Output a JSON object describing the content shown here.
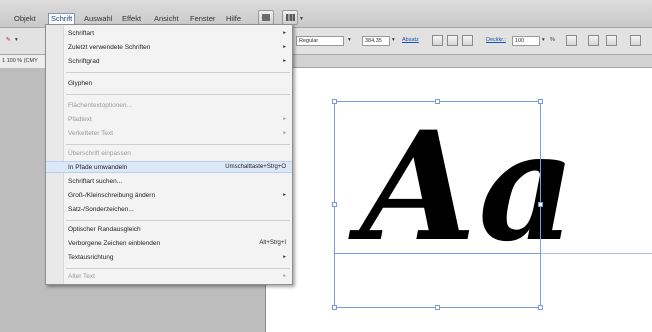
{
  "menubar": {
    "items": [
      "Objekt",
      "Schrift",
      "Auswahl",
      "Effekt",
      "Ansicht",
      "Fenster",
      "Hilfe"
    ],
    "active": "Schrift"
  },
  "controlbar": {
    "style_value": "Regular",
    "size_value": "384,35",
    "link_absatz": "Absatz",
    "opacity_label": "Deckkr.:",
    "opacity_value": "100",
    "percent": "%"
  },
  "document_tab": {
    "label": "1 100 % (CMY"
  },
  "artwork": {
    "text": "Aa"
  },
  "menu": {
    "items": [
      {
        "label": "Schriftart",
        "shortcut": "",
        "submenu": true,
        "enabled": true
      },
      {
        "label": "Zuletzt verwendete Schriften",
        "shortcut": "",
        "submenu": true,
        "enabled": true
      },
      {
        "label": "Schriftgrad",
        "shortcut": "",
        "submenu": true,
        "enabled": true
      },
      {
        "label": "Glyphen",
        "shortcut": "",
        "submenu": false,
        "enabled": true
      },
      {
        "label": "Flächentextoptionen...",
        "shortcut": "",
        "submenu": false,
        "enabled": false
      },
      {
        "label": "Pfadtext",
        "shortcut": "",
        "submenu": true,
        "enabled": false
      },
      {
        "label": "Verketteter Text",
        "shortcut": "",
        "submenu": true,
        "enabled": false
      },
      {
        "label": "Überschrift einpassen",
        "shortcut": "",
        "submenu": false,
        "enabled": false
      },
      {
        "label": "In Pfade umwandeln",
        "shortcut": "Umschalttaste+Strg+O",
        "submenu": false,
        "enabled": true,
        "highlighted": true
      },
      {
        "label": "Schriftart suchen...",
        "shortcut": "",
        "submenu": false,
        "enabled": true
      },
      {
        "label": "Groß-/Kleinschreibung ändern",
        "shortcut": "",
        "submenu": true,
        "enabled": true
      },
      {
        "label": "Satz-/Sonderzeichen...",
        "shortcut": "",
        "submenu": false,
        "enabled": true
      },
      {
        "label": "Optischer Randausgleich",
        "shortcut": "",
        "submenu": false,
        "enabled": true
      },
      {
        "label": "Verborgene Zeichen einblenden",
        "shortcut": "Alt+Strg+I",
        "submenu": false,
        "enabled": true
      },
      {
        "label": "Textausrichtung",
        "shortcut": "",
        "submenu": true,
        "enabled": true
      },
      {
        "label": "Alter Text",
        "shortcut": "",
        "submenu": true,
        "enabled": false
      }
    ]
  },
  "icons": {
    "submenu_arrow": "▸",
    "caret": "▾"
  }
}
